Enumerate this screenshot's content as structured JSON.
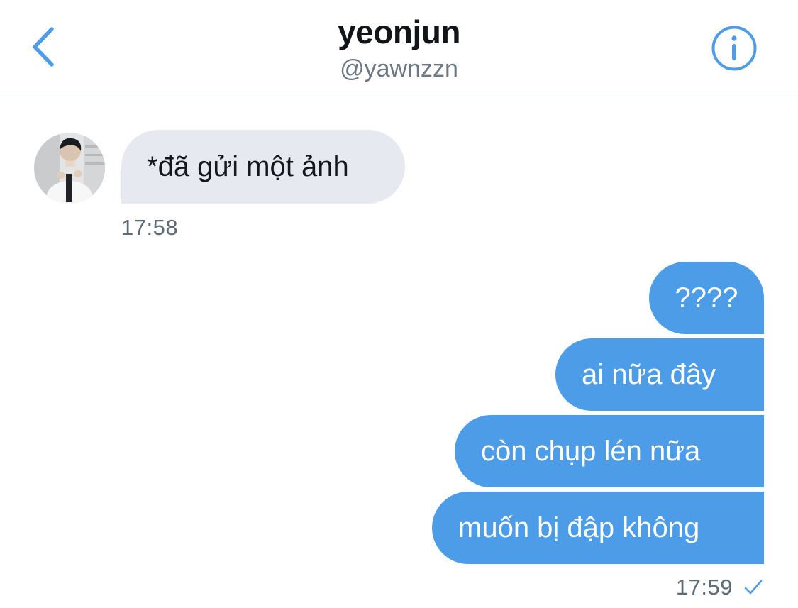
{
  "header": {
    "title": "yeonjun",
    "handle": "@yawnzzn",
    "back_icon": "chevron-left-icon",
    "info_icon": "info-circle-icon",
    "accent_color": "#4c9ce8"
  },
  "messages": {
    "incoming": {
      "text": "*đã gửi một ảnh",
      "time": "17:58"
    },
    "outgoing": [
      {
        "text": "????"
      },
      {
        "text": "ai nữa đây"
      },
      {
        "text": "còn chụp lén nữa"
      },
      {
        "text": "muốn bị đập không"
      }
    ],
    "outgoing_time": "17:59",
    "read_icon": "checkmark-icon"
  },
  "colors": {
    "outgoing_bubble": "#4c9ce8",
    "incoming_bubble": "#e6eaf0",
    "timestamp": "#5e6b77"
  }
}
